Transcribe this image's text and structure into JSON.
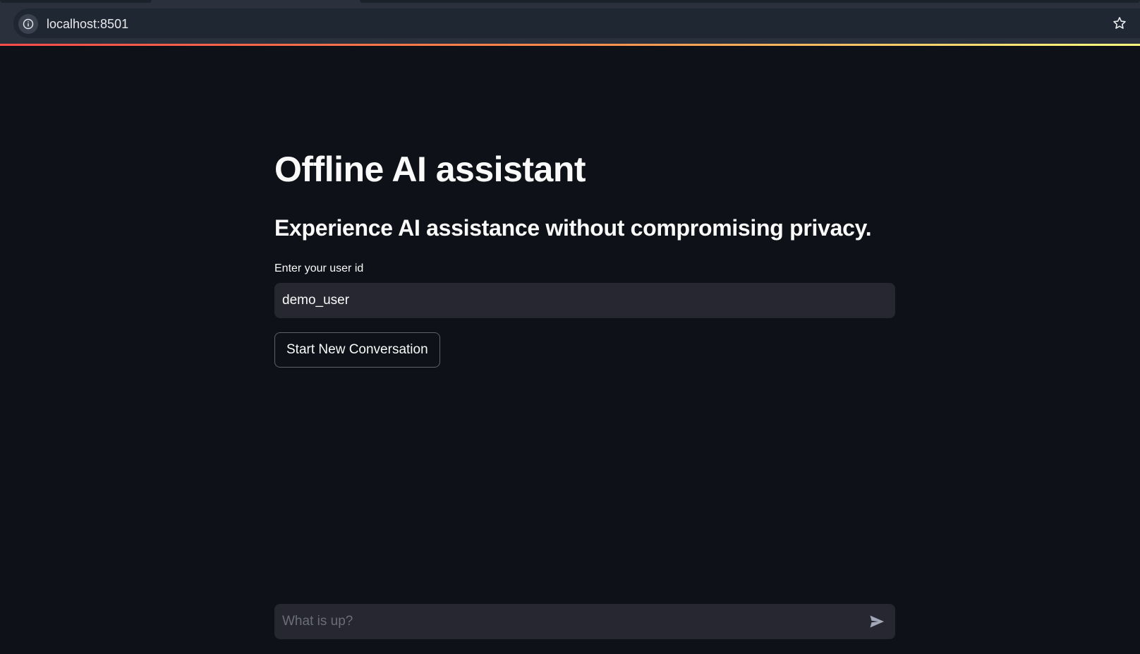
{
  "browser": {
    "url": "localhost:8501",
    "info_icon": "info-icon",
    "bookmark_icon": "star-icon"
  },
  "app": {
    "title": "Offline AI assistant",
    "subtitle": "Experience AI assistance without compromising privacy.",
    "user_id_label": "Enter your user id",
    "user_id_value": "demo_user",
    "new_conversation_button": "Start New Conversation"
  },
  "chat": {
    "placeholder": "What is up?",
    "send_icon": "send-icon"
  },
  "colors": {
    "background": "#0e1117",
    "input_background": "#262730",
    "accent_gradient_start": "#ff4b4b",
    "accent_gradient_end": "#fffd80"
  }
}
